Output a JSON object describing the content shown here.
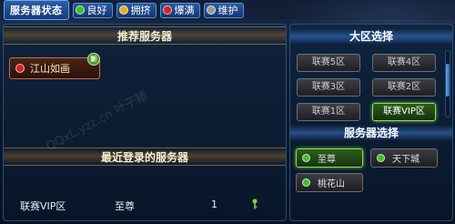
{
  "status_legend": {
    "title": "服务器状态",
    "items": [
      {
        "label": "良好",
        "color": "#3fbf2a"
      },
      {
        "label": "拥挤",
        "color": "#e8b020"
      },
      {
        "label": "爆满",
        "color": "#d82020"
      },
      {
        "label": "维护",
        "color": "#9a9a9a"
      }
    ]
  },
  "recommended": {
    "header": "推荐服务器",
    "server": {
      "name": "江山如画",
      "status_color": "#d82020",
      "badge": "新"
    }
  },
  "recent": {
    "header": "最近登录的服务器",
    "row": {
      "region": "联赛VIP区",
      "server": "至尊",
      "count": "1"
    }
  },
  "region_select": {
    "header": "大区选择",
    "buttons": [
      {
        "label": "联赛5区",
        "active": false
      },
      {
        "label": "联赛4区",
        "active": false
      },
      {
        "label": "联赛3区",
        "active": false
      },
      {
        "label": "联赛2区",
        "active": false
      },
      {
        "label": "联赛1区",
        "active": false
      },
      {
        "label": "联赛VIP区",
        "active": true
      }
    ]
  },
  "server_select": {
    "header": "服务器选择",
    "buttons": [
      {
        "label": "至尊",
        "status_color": "#3fbf2a",
        "active": true
      },
      {
        "label": "天下城",
        "status_color": "#3fbf2a",
        "active": false
      },
      {
        "label": "桃花山",
        "status_color": "#3fbf2a",
        "active": false
      }
    ]
  },
  "watermark": {
    "text": "QQxL.yzz.cn 叶子猪"
  },
  "accent": {
    "selected_green": "#8ee04a",
    "header_gold": "#f4f0d0"
  }
}
